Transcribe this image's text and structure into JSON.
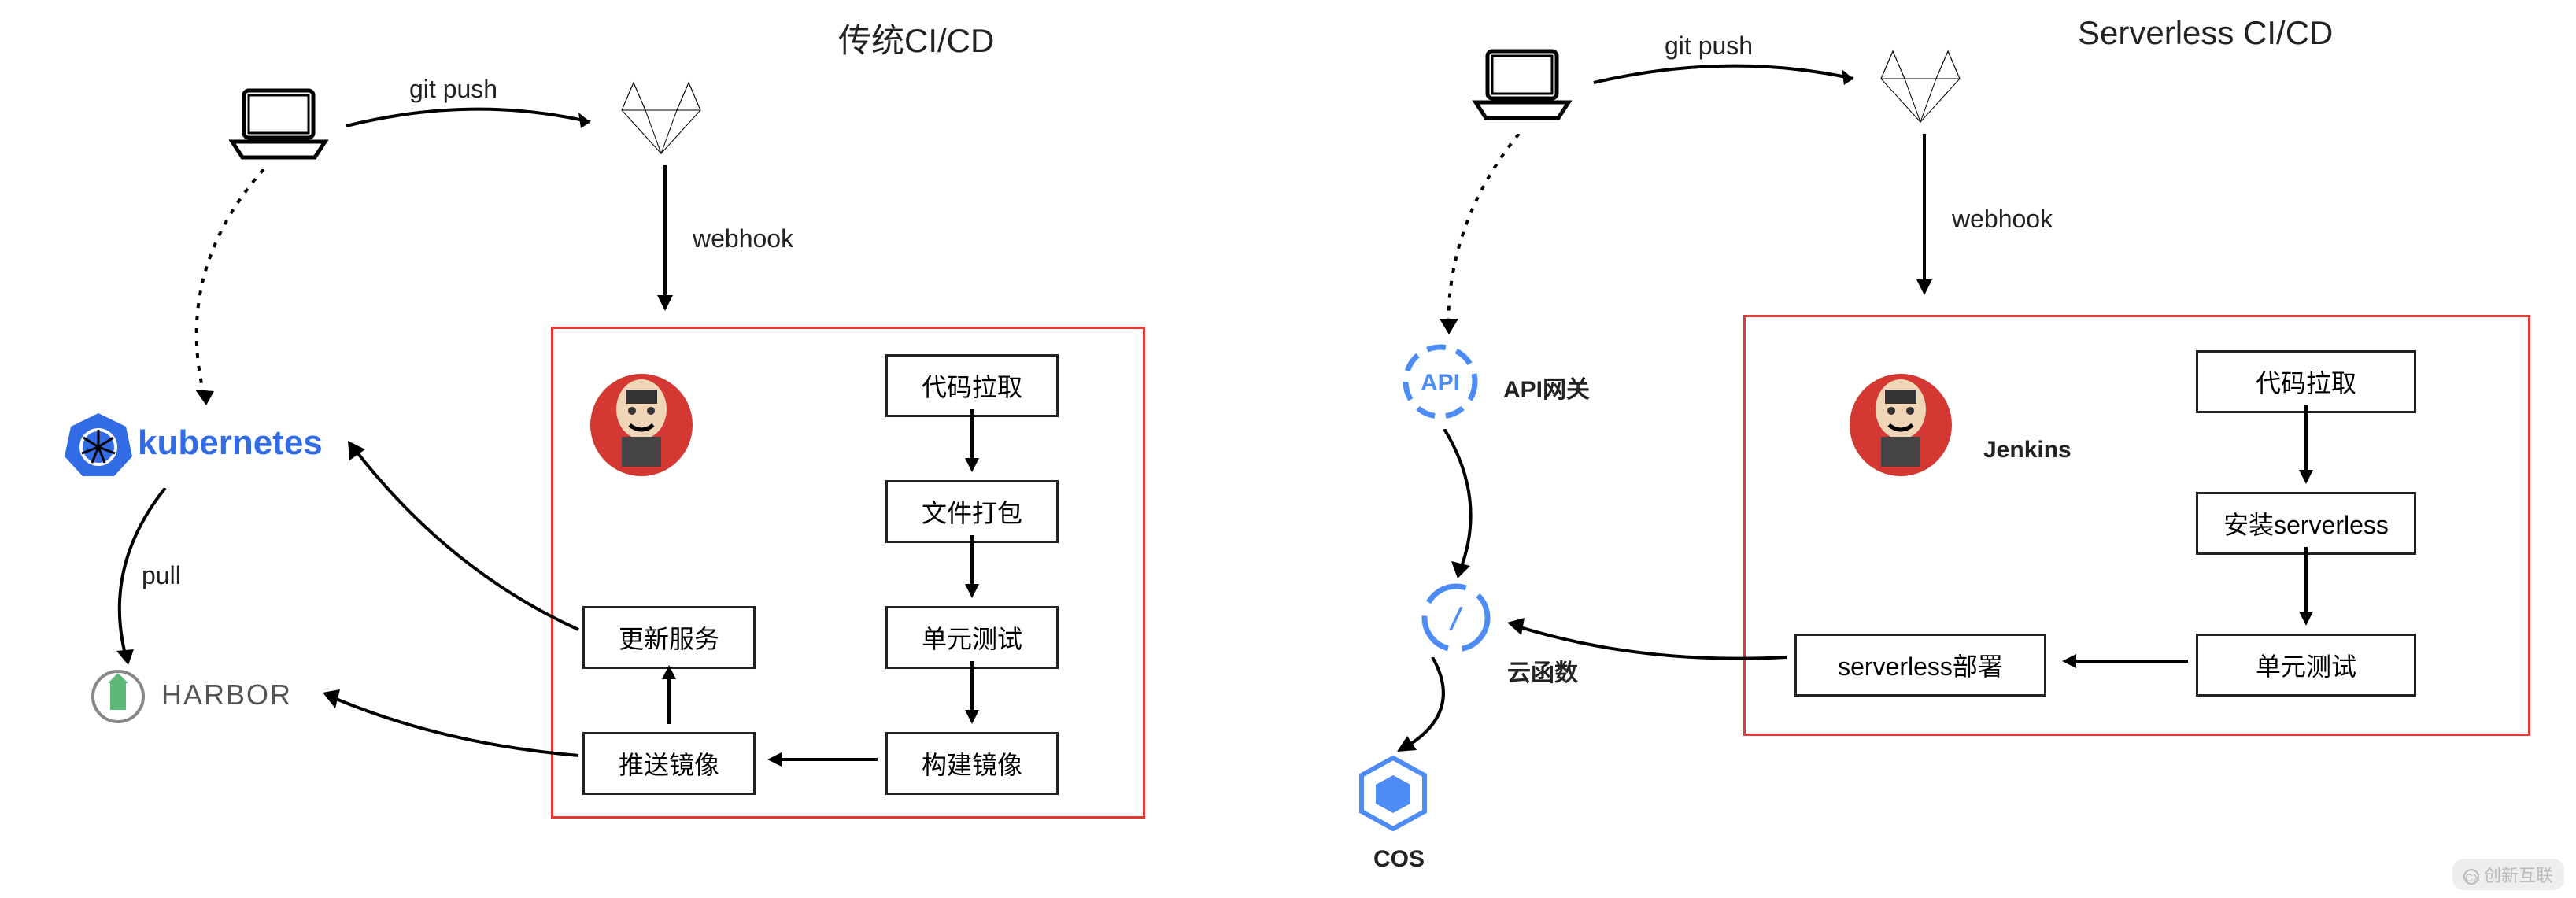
{
  "diagram": {
    "left": {
      "title": "传统CI/CD",
      "git_push": "git push",
      "webhook": "webhook",
      "pull": "pull",
      "kubernetes": "kubernetes",
      "harbor": "HARBOR",
      "steps": {
        "code_pull": "代码拉取",
        "file_pack": "文件打包",
        "unit_test": "单元测试",
        "build_image": "构建镜像",
        "push_image": "推送镜像",
        "update_service": "更新服务"
      }
    },
    "right": {
      "title": "Serverless CI/CD",
      "git_push": "git push",
      "webhook": "webhook",
      "api_gateway": "API网关",
      "cloud_function": "云函数",
      "cos": "COS",
      "jenkins": "Jenkins",
      "steps": {
        "code_pull": "代码拉取",
        "install_serverless": "安装serverless",
        "unit_test": "单元测试",
        "serverless_deploy": "serverless部署"
      }
    },
    "watermark": "创新互联"
  },
  "chart_data": {
    "type": "diagram",
    "panels": [
      {
        "name": "传统CI/CD",
        "nodes": [
          {
            "id": "laptop",
            "type": "icon",
            "label": "laptop"
          },
          {
            "id": "gitlab",
            "type": "icon",
            "label": "GitLab"
          },
          {
            "id": "kubernetes",
            "type": "icon",
            "label": "kubernetes"
          },
          {
            "id": "harbor",
            "type": "icon",
            "label": "HARBOR"
          },
          {
            "id": "jenkins",
            "type": "icon",
            "label": "Jenkins",
            "container": "jenkins-box"
          },
          {
            "id": "code_pull",
            "type": "step",
            "label": "代码拉取",
            "container": "jenkins-box"
          },
          {
            "id": "file_pack",
            "type": "step",
            "label": "文件打包",
            "container": "jenkins-box"
          },
          {
            "id": "unit_test",
            "type": "step",
            "label": "单元测试",
            "container": "jenkins-box"
          },
          {
            "id": "build_image",
            "type": "step",
            "label": "构建镜像",
            "container": "jenkins-box"
          },
          {
            "id": "push_image",
            "type": "step",
            "label": "推送镜像",
            "container": "jenkins-box"
          },
          {
            "id": "update_service",
            "type": "step",
            "label": "更新服务",
            "container": "jenkins-box"
          }
        ],
        "edges": [
          {
            "from": "laptop",
            "to": "gitlab",
            "label": "git push",
            "style": "solid"
          },
          {
            "from": "gitlab",
            "to": "jenkins-box",
            "label": "webhook",
            "style": "solid"
          },
          {
            "from": "code_pull",
            "to": "file_pack",
            "style": "solid"
          },
          {
            "from": "file_pack",
            "to": "unit_test",
            "style": "solid"
          },
          {
            "from": "unit_test",
            "to": "build_image",
            "style": "solid"
          },
          {
            "from": "build_image",
            "to": "push_image",
            "style": "solid"
          },
          {
            "from": "push_image",
            "to": "update_service",
            "style": "solid"
          },
          {
            "from": "push_image",
            "to": "harbor",
            "style": "solid"
          },
          {
            "from": "update_service",
            "to": "kubernetes",
            "style": "solid"
          },
          {
            "from": "laptop",
            "to": "kubernetes",
            "style": "dotted"
          },
          {
            "from": "kubernetes",
            "to": "harbor",
            "label": "pull",
            "style": "solid"
          }
        ]
      },
      {
        "name": "Serverless CI/CD",
        "nodes": [
          {
            "id": "laptop",
            "type": "icon",
            "label": "laptop"
          },
          {
            "id": "gitlab",
            "type": "icon",
            "label": "GitLab"
          },
          {
            "id": "api_gateway",
            "type": "icon",
            "label": "API网关"
          },
          {
            "id": "cloud_function",
            "type": "icon",
            "label": "云函数"
          },
          {
            "id": "cos",
            "type": "icon",
            "label": "COS"
          },
          {
            "id": "jenkins",
            "type": "icon",
            "label": "Jenkins",
            "container": "jenkins-box"
          },
          {
            "id": "code_pull",
            "type": "step",
            "label": "代码拉取",
            "container": "jenkins-box"
          },
          {
            "id": "install_serverless",
            "type": "step",
            "label": "安装serverless",
            "container": "jenkins-box"
          },
          {
            "id": "unit_test",
            "type": "step",
            "label": "单元测试",
            "container": "jenkins-box"
          },
          {
            "id": "serverless_deploy",
            "type": "step",
            "label": "serverless部署",
            "container": "jenkins-box"
          }
        ],
        "edges": [
          {
            "from": "laptop",
            "to": "gitlab",
            "label": "git push",
            "style": "solid"
          },
          {
            "from": "gitlab",
            "to": "jenkins-box",
            "label": "webhook",
            "style": "solid"
          },
          {
            "from": "code_pull",
            "to": "install_serverless",
            "style": "solid"
          },
          {
            "from": "install_serverless",
            "to": "unit_test",
            "style": "solid"
          },
          {
            "from": "unit_test",
            "to": "serverless_deploy",
            "style": "solid"
          },
          {
            "from": "serverless_deploy",
            "to": "cloud_function",
            "style": "solid"
          },
          {
            "from": "laptop",
            "to": "api_gateway",
            "style": "dotted"
          },
          {
            "from": "api_gateway",
            "to": "cloud_function",
            "style": "solid"
          },
          {
            "from": "cloud_function",
            "to": "cos",
            "style": "solid"
          }
        ]
      }
    ]
  }
}
